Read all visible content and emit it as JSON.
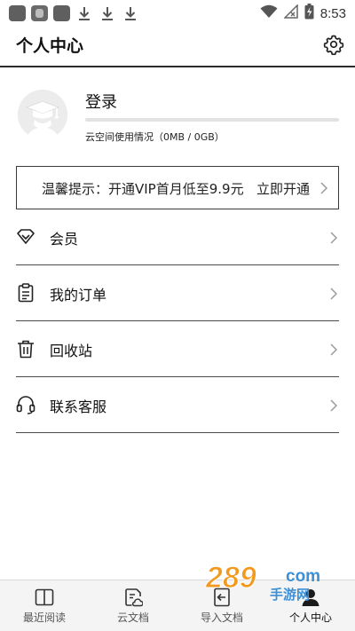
{
  "status_bar": {
    "time": "8:53",
    "left_icons": [
      "app-icon",
      "cat-app-icon",
      "app-icon",
      "download-icon",
      "download-icon",
      "download-icon"
    ],
    "right_icons": [
      "wifi-icon",
      "signal-off-icon",
      "battery-charging-icon"
    ]
  },
  "header": {
    "title": "个人中心",
    "settings_icon": "gear-icon"
  },
  "profile": {
    "login_label": "登录",
    "storage_text": "云空间使用情况（0MB / 0GB）",
    "storage_used_fraction": 0.0
  },
  "vip_banner": {
    "tip": "温馨提示：开通VIP首月低至9.9元",
    "action": "立即开通"
  },
  "menu": {
    "items": [
      {
        "label": "会员",
        "icon": "diamond-icon"
      },
      {
        "label": "我的订单",
        "icon": "clipboard-icon"
      },
      {
        "label": "回收站",
        "icon": "trash-icon"
      },
      {
        "label": "联系客服",
        "icon": "headset-icon"
      }
    ]
  },
  "bottom_nav": {
    "items": [
      {
        "label": "最近阅读",
        "icon": "book-icon"
      },
      {
        "label": "云文档",
        "icon": "cloud-document-icon"
      },
      {
        "label": "导入文档",
        "icon": "import-icon"
      },
      {
        "label": "个人中心",
        "icon": "person-icon"
      }
    ],
    "active_index": 3
  },
  "watermark": {
    "text_main": "289",
    "text_suffix": "com",
    "text_sub": "手游网"
  },
  "colors": {
    "text": "#111111",
    "divider": "#4a4a4a",
    "nav_bg": "#f4f4f4",
    "watermark_orange": "#f29a1f",
    "watermark_blue": "#3d8fd6"
  }
}
